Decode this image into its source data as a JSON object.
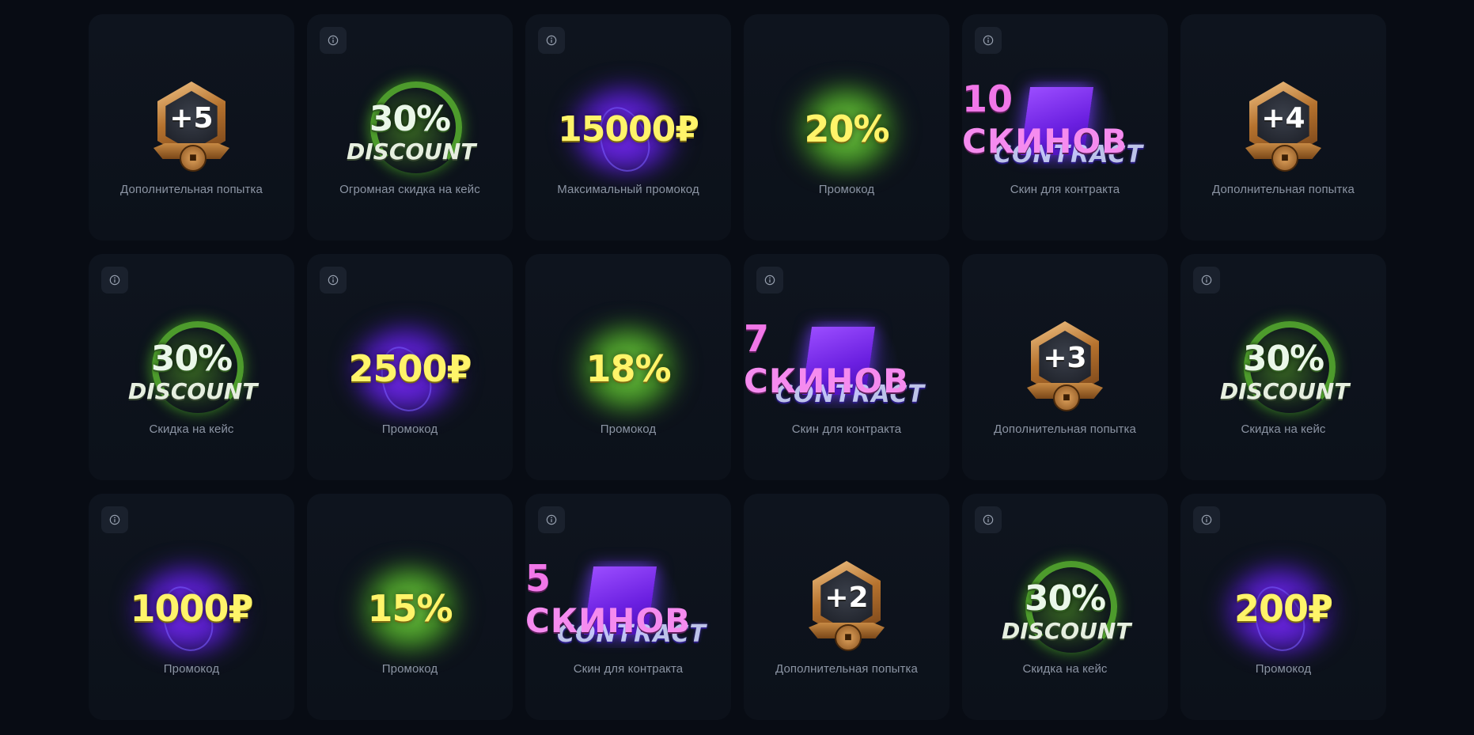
{
  "cards": [
    {
      "type": "attempt",
      "info": false,
      "value": "+5",
      "label": "Дополнительная попытка"
    },
    {
      "type": "discount",
      "info": true,
      "value": "30%",
      "word": "DISCOUNT",
      "label": "Огромная скидка на кейс"
    },
    {
      "type": "promo",
      "info": true,
      "value": "15000₽",
      "glow": "purple",
      "label": "Максимальный промокод"
    },
    {
      "type": "promo",
      "info": false,
      "value": "20%",
      "glow": "green",
      "label": "Промокод"
    },
    {
      "type": "contract",
      "info": true,
      "count": "10",
      "word": "СКИНОВ",
      "sub": "CONTRACT",
      "label": "Скин для контракта"
    },
    {
      "type": "attempt",
      "info": false,
      "value": "+4",
      "label": "Дополнительная попытка"
    },
    {
      "type": "discount",
      "info": true,
      "value": "30%",
      "word": "DISCOUNT",
      "label": "Скидка на кейс"
    },
    {
      "type": "promo",
      "info": true,
      "value": "2500₽",
      "glow": "purple",
      "label": "Промокод"
    },
    {
      "type": "promo",
      "info": false,
      "value": "18%",
      "glow": "green",
      "label": "Промокод"
    },
    {
      "type": "contract",
      "info": true,
      "count": "7",
      "word": "СКИНОВ",
      "sub": "CONTRACT",
      "label": "Скин для контракта"
    },
    {
      "type": "attempt",
      "info": false,
      "value": "+3",
      "label": "Дополнительная попытка"
    },
    {
      "type": "discount",
      "info": true,
      "value": "30%",
      "word": "DISCOUNT",
      "label": "Скидка на кейс"
    },
    {
      "type": "promo",
      "info": true,
      "value": "1000₽",
      "glow": "purple",
      "label": "Промокод"
    },
    {
      "type": "promo",
      "info": false,
      "value": "15%",
      "glow": "green",
      "label": "Промокод"
    },
    {
      "type": "contract",
      "info": true,
      "count": "5",
      "word": "СКИНОВ",
      "sub": "CONTRACT",
      "label": "Скин для контракта"
    },
    {
      "type": "attempt",
      "info": false,
      "value": "+2",
      "label": "Дополнительная попытка"
    },
    {
      "type": "discount",
      "info": true,
      "value": "30%",
      "word": "DISCOUNT",
      "label": "Скидка на кейс"
    },
    {
      "type": "promo",
      "info": true,
      "value": "200₽",
      "glow": "purple",
      "label": "Промокод"
    }
  ],
  "icons": {
    "info": "info-icon",
    "gift": "gift-icon"
  },
  "colors": {
    "background": "#080c14",
    "card": "#0e141e",
    "label": "#8b94a3",
    "promo_text": "#fff46a",
    "skins_text": "#f58bef"
  }
}
